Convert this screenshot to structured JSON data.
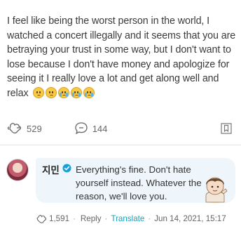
{
  "post": {
    "text": "I feel like being the worst person in the world, I watched a concert illegally and it seems that you are betraying your trust in some way, but I don't want to lose because I don't have money and apologize for seeing it I really love a lot and get along well and relax",
    "emojis": [
      "frowning-face",
      "frowning-face",
      "crying-face",
      "crying-face",
      "crying-face"
    ]
  },
  "actions": {
    "likes": "529",
    "comments": "144"
  },
  "reply": {
    "author": "지민",
    "text": "Everything's fine. Don't hate yourself instead. Whatever the reason, we'll love you.",
    "likes": "1,591",
    "reply_label": "Reply",
    "translate_label": "Translate",
    "timestamp": "Jun 14, 2021, 15:17",
    "separator": "·"
  },
  "colors": {
    "accent_translate": "#17a3b8",
    "bubble_bg": "#eef6fb",
    "verified_badge": "#1a9fd8"
  }
}
